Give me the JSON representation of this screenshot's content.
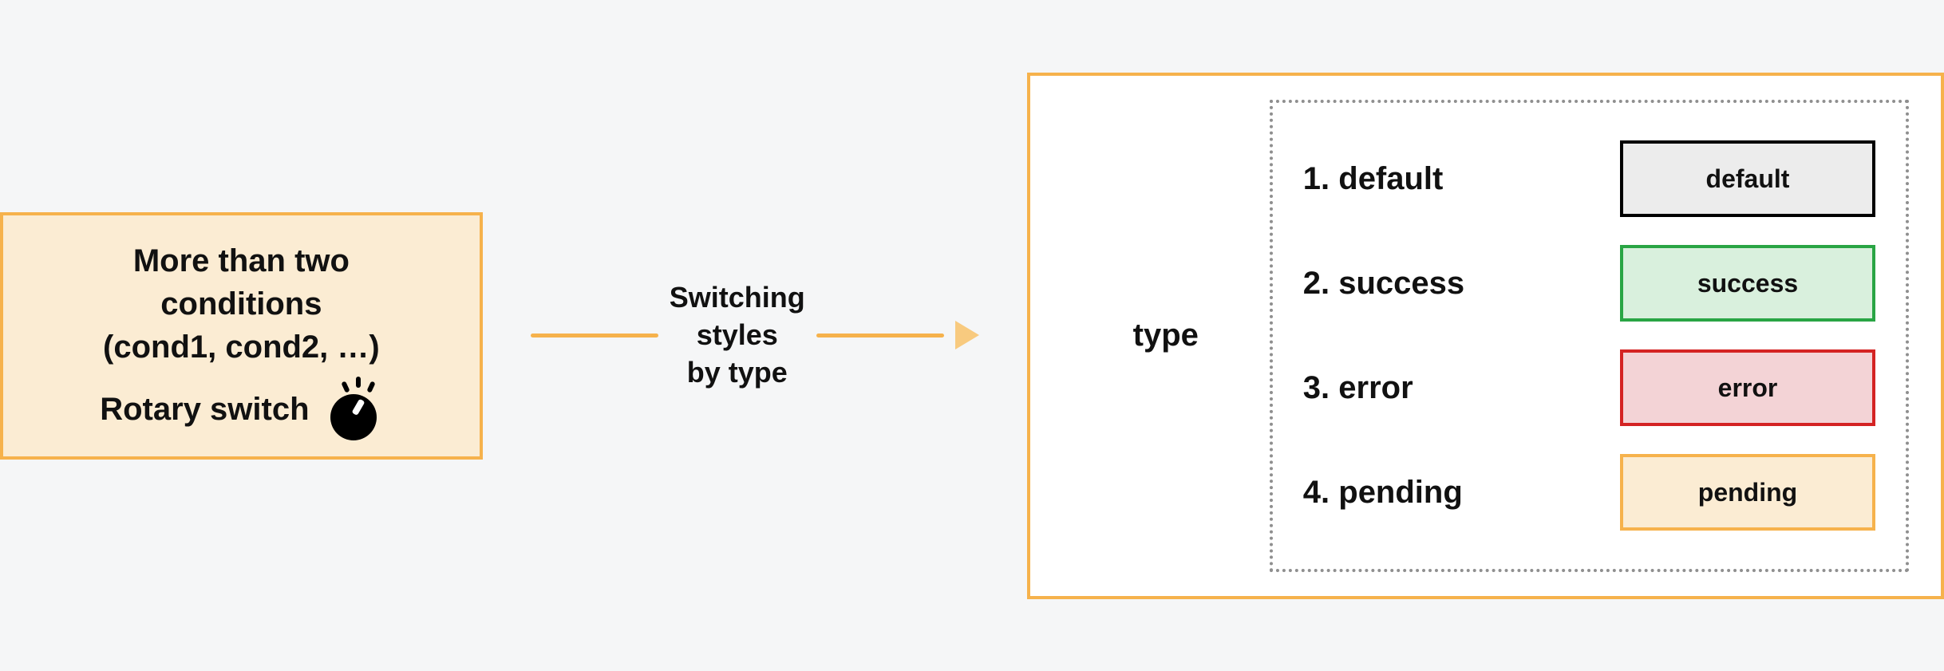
{
  "leftBox": {
    "line1": "More than two",
    "line2": "conditions",
    "line3": "(cond1, cond2, …)",
    "footer": "Rotary switch"
  },
  "middle": {
    "line1": "Switching",
    "line2": "styles",
    "line3": "by type"
  },
  "right": {
    "label": "type",
    "entries": {
      "0": {
        "text": "1. default",
        "swatch": "default"
      },
      "1": {
        "text": "2. success",
        "swatch": "success"
      },
      "2": {
        "text": "3. error",
        "swatch": "error"
      },
      "3": {
        "text": "4. pending",
        "swatch": "pending"
      }
    }
  }
}
